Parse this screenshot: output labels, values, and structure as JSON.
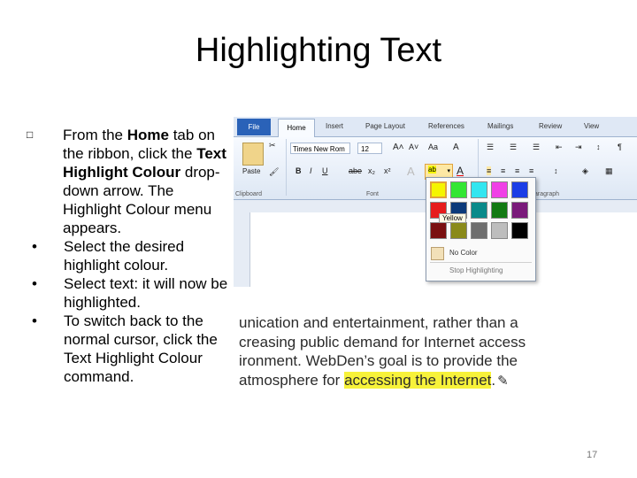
{
  "title": "Highlighting Text",
  "bullets": {
    "first": {
      "p1": "From the ",
      "b1": "Home",
      "p2": " tab on the ribbon, click the ",
      "b2": "Text Highlight Colour",
      "p3": " drop-down arrow. The Highlight Colour menu appears."
    },
    "items": [
      "Select the desired highlight colour.",
      "Select text: it will now be highlighted.",
      "To switch back to the normal cursor, click the Text Highlight Colour command."
    ]
  },
  "word": {
    "tabs": [
      "File",
      "Home",
      "Insert",
      "Page Layout",
      "References",
      "Mailings",
      "Review",
      "View"
    ],
    "font_name": "Times New Rom",
    "font_size": "12",
    "groups": {
      "clipboard": "Clipboard",
      "font": "Font",
      "paragraph": "aragraph"
    },
    "paste_label": "Paste",
    "format_buttons": [
      "B",
      "I",
      "U",
      "abe",
      "x₂",
      "x²"
    ],
    "palette": {
      "colors": [
        "#f5f500",
        "#33e633",
        "#33e6f0",
        "#f040e6",
        "#1c3ee6",
        "#e61c1c",
        "#0c3a7a",
        "#0a8a8a",
        "#137a13",
        "#7a1a7a",
        "#7a1010",
        "#8a8a1a",
        "#6e6e6e",
        "#bdbdbd",
        "#000000"
      ],
      "tooltip": "Yellow",
      "no_color": "No Color",
      "stop": "Stop Highlighting"
    }
  },
  "doc_lines": [
    {
      "pre": "unication  and entertainment,  rather than  a",
      "hl": "",
      "post": ""
    },
    {
      "pre": "creasing public demand for Internet access",
      "hl": "",
      "post": ""
    },
    {
      "pre": "ironment. WebDen’s goal is to provide the",
      "hl": "",
      "post": ""
    },
    {
      "pre": "atmosphere for ",
      "hl": "accessing the Internet",
      "post": "."
    }
  ],
  "page_number": "17"
}
